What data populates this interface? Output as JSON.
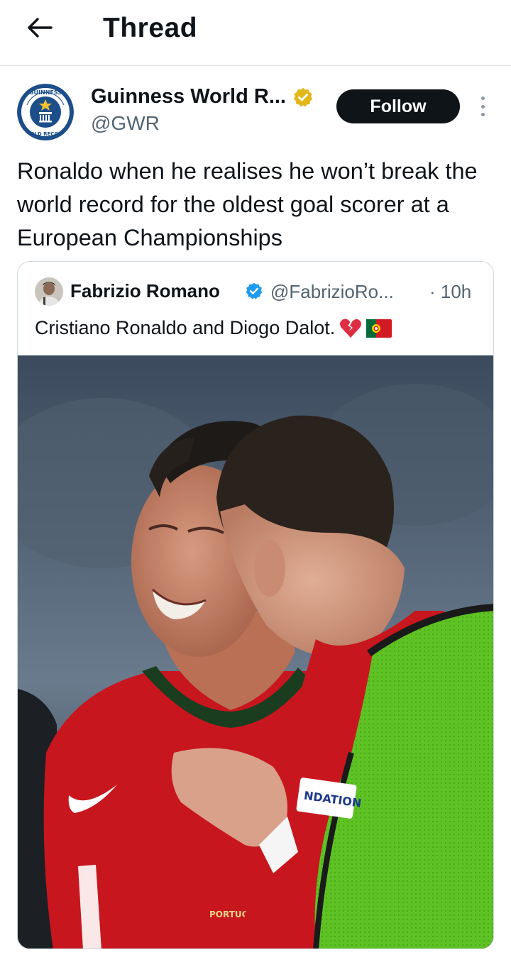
{
  "header": {
    "title": "Thread",
    "back_icon": "arrow-left-icon"
  },
  "tweet": {
    "author_name": "Guinness World R...",
    "author_handle": "@GWR",
    "verified_badge": "gold-verified-icon",
    "follow_label": "Follow",
    "more_icon": "more-vertical-icon",
    "text": "Ronaldo when he realises he won’t break the world record for the oldest goal scorer at a European Championships",
    "avatar_logo_text": "GUINNESS WORLD RECORDS"
  },
  "quote": {
    "author_name": "Fabrizio Romano",
    "author_handle": "@FabrizioRo...",
    "time": "· 10h",
    "text": "Cristiano Ronaldo and Diogo Dalot.",
    "emojis": [
      "broken-heart-icon",
      "portugal-flag-icon"
    ],
    "photo_jersey_text": "NDATION",
    "photo_chest_text": "PORTUGAL"
  },
  "colors": {
    "accent_dark": "#0f1419",
    "muted": "#536471",
    "verified_gold": "#e2b719",
    "verified_blue": "#1d9bf0",
    "portugal_red": "#d21a22",
    "bib_green": "#6ed12a"
  }
}
